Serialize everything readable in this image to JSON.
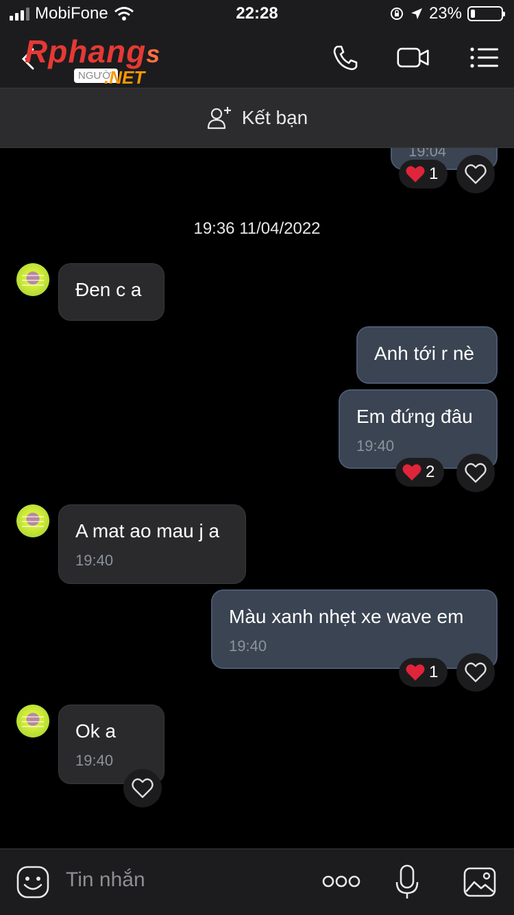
{
  "status_bar": {
    "carrier": "MobiFone",
    "time": "22:28",
    "battery_percent": "23%"
  },
  "header": {
    "logo": {
      "brand": "Rphang",
      "brand_suffix": "s",
      "tagline": "NGƯỜI",
      "suffix": ".NET"
    },
    "icons": [
      "back-icon",
      "phone-icon",
      "video-call-icon",
      "menu-icon"
    ]
  },
  "add_friend": {
    "label": "Kết bạn"
  },
  "chat": {
    "top_partial": {
      "time": "19:04",
      "reaction_count": "1"
    },
    "date_separator": "19:36 11/04/2022",
    "messages": [
      {
        "direction": "in",
        "text": "Đen c a"
      },
      {
        "direction": "out",
        "text": "Anh tới r nè"
      },
      {
        "direction": "out",
        "text": "Em đứng đâu",
        "time": "19:40",
        "reaction_count": "2"
      },
      {
        "direction": "in",
        "text": "A mat ao mau j a",
        "time": "19:40"
      },
      {
        "direction": "out",
        "text": "Màu xanh nhẹt xe wave em",
        "time": "19:40",
        "reaction_count": "1"
      },
      {
        "direction": "in",
        "text": "Ok a",
        "time": "19:40"
      }
    ]
  },
  "composer": {
    "placeholder": "Tin nhắn",
    "icons": [
      "emoji-icon",
      "more-icon",
      "microphone-icon",
      "image-icon"
    ]
  },
  "colors": {
    "outgoing_bubble": "#3a4452",
    "incoming_bubble": "#2a2a2c",
    "background": "#000000",
    "reaction_heart": "#e0243a"
  }
}
